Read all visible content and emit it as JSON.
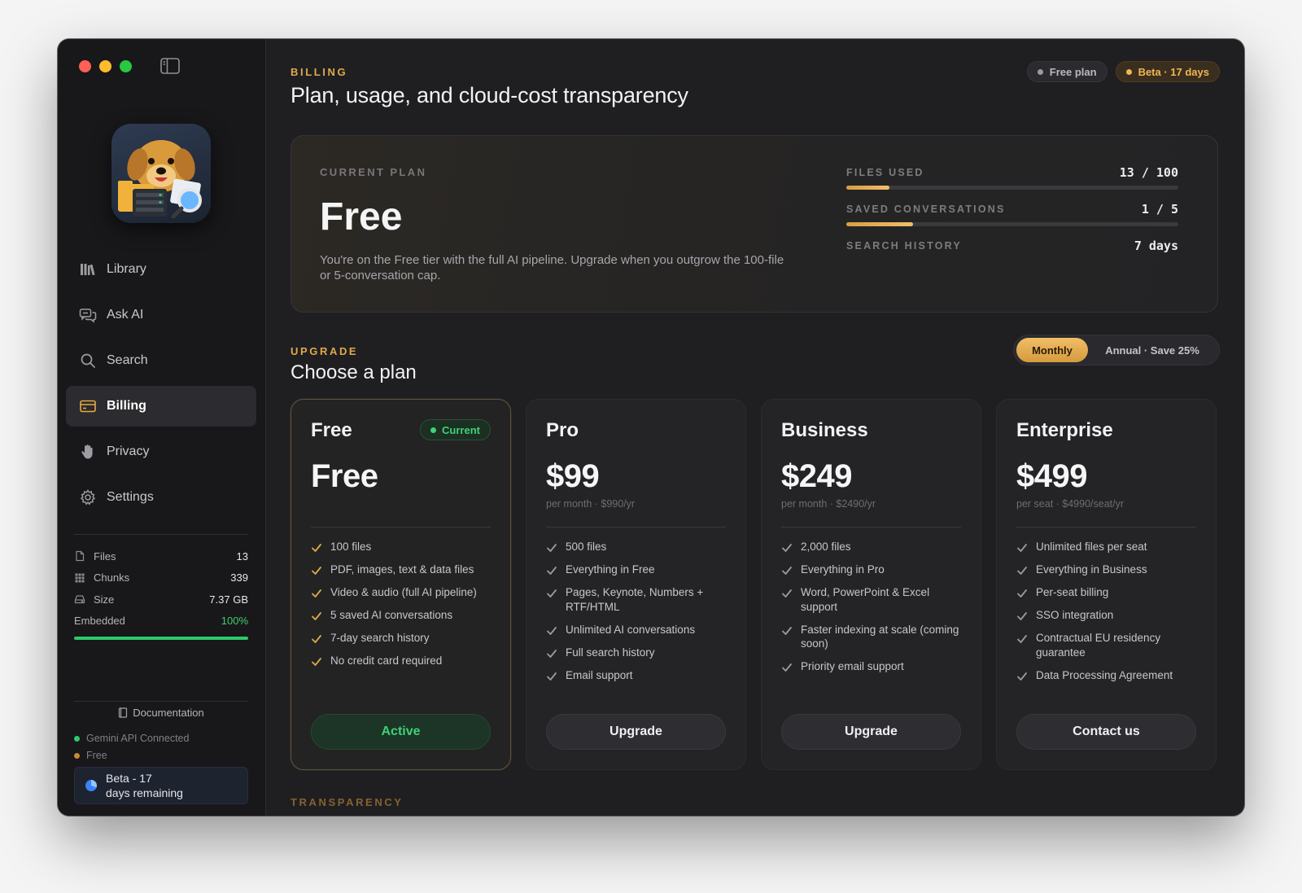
{
  "sidebar": {
    "nav": [
      {
        "label": "Library",
        "icon": "library-icon"
      },
      {
        "label": "Ask AI",
        "icon": "chat-icon"
      },
      {
        "label": "Search",
        "icon": "search-icon"
      },
      {
        "label": "Billing",
        "icon": "credit-card-icon"
      },
      {
        "label": "Privacy",
        "icon": "hand-icon"
      },
      {
        "label": "Settings",
        "icon": "gear-icon"
      }
    ],
    "active_item": "Billing",
    "stats": {
      "files_label": "Files",
      "files_value": "13",
      "chunks_label": "Chunks",
      "chunks_value": "339",
      "size_label": "Size",
      "size_value": "7.37 GB",
      "embedded_label": "Embedded",
      "embedded_value": "100%",
      "embedded_fraction": 1.0
    },
    "documentation_label": "Documentation",
    "api_status": "Gemini API Connected",
    "plan_status": "Free",
    "beta_label_line1": "Beta - 17",
    "beta_label_line2": "days remaining"
  },
  "header": {
    "eyebrow": "BILLING",
    "title": "Plan, usage, and cloud-cost transparency",
    "badge_plan": "Free plan",
    "badge_beta": "Beta · 17 days"
  },
  "current_plan": {
    "label": "CURRENT PLAN",
    "name": "Free",
    "description": "You're on the Free tier with the full AI pipeline. Upgrade when you outgrow the 100-file or 5-conversation cap.",
    "usage": [
      {
        "label": "FILES USED",
        "value": "13 / 100",
        "fraction": 0.13
      },
      {
        "label": "SAVED CONVERSATIONS",
        "value": "1 / 5",
        "fraction": 0.2
      },
      {
        "label": "SEARCH HISTORY",
        "value": "7 days"
      }
    ]
  },
  "upgrade": {
    "eyebrow": "UPGRADE",
    "title": "Choose a plan",
    "toggle_monthly": "Monthly",
    "toggle_annual": "Annual · Save 25%",
    "selected": "Monthly"
  },
  "plans": [
    {
      "name": "Free",
      "badge": "Current",
      "price": "Free",
      "sub": "",
      "features": [
        "100 files",
        "PDF, images, text & data files",
        "Video & audio (full AI pipeline)",
        "5 saved AI conversations",
        "7-day search history",
        "No credit card required"
      ],
      "button": "Active"
    },
    {
      "name": "Pro",
      "price": "$99",
      "sub": "per month · $990/yr",
      "features": [
        "500 files",
        "Everything in Free",
        "Pages, Keynote, Numbers + RTF/HTML",
        "Unlimited AI conversations",
        "Full search history",
        "Email support"
      ],
      "button": "Upgrade"
    },
    {
      "name": "Business",
      "price": "$249",
      "sub": "per month · $2490/yr",
      "features": [
        "2,000 files",
        "Everything in Pro",
        "Word, PowerPoint & Excel support",
        "Faster indexing at scale (coming soon)",
        "Priority email support"
      ],
      "button": "Upgrade"
    },
    {
      "name": "Enterprise",
      "price": "$499",
      "sub": "per seat · $4990/seat/yr",
      "features": [
        "Unlimited files per seat",
        "Everything in Business",
        "Per-seat billing",
        "SSO integration",
        "Contractual EU residency guarantee",
        "Data Processing Agreement"
      ],
      "button": "Contact us"
    }
  ],
  "transparency_eyebrow": "TRANSPARENCY",
  "colors": {
    "accent_gold": "#e0a94a",
    "success_green": "#3fd07a",
    "window_bg": "#1f1f22",
    "sidebar_bg": "#18181a"
  }
}
